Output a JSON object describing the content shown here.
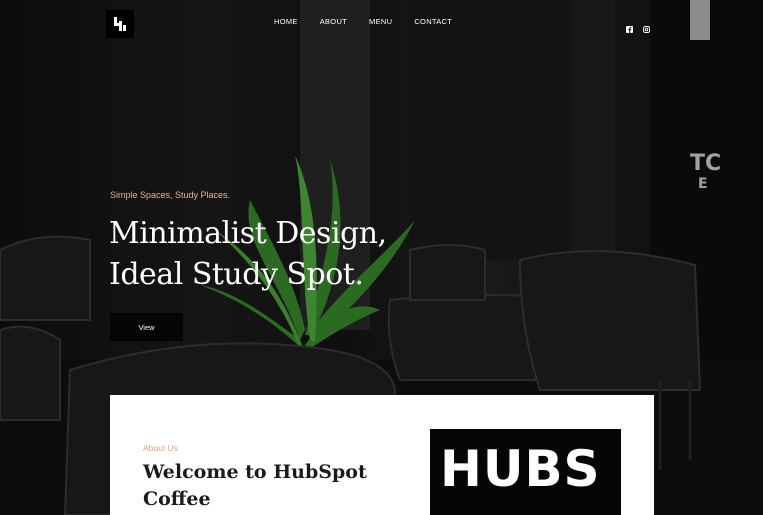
{
  "nav": {
    "items": [
      "HOME",
      "ABOUT",
      "MENU",
      "CONTACT"
    ]
  },
  "social": {
    "icons": [
      "facebook-icon",
      "instagram-icon"
    ]
  },
  "hero": {
    "tagline": "Simple Spaces, Study Places.",
    "headline_line1": "Minimalist Design,",
    "headline_line2": "Ideal Study Spot.",
    "button_label": "View"
  },
  "about": {
    "eyebrow": "About Us",
    "title": "Welcome to HubSpot Coffee",
    "image_text": "HUBS"
  },
  "colors": {
    "accent": "#e9b48f",
    "card_bg": "#ffffff",
    "dark": "#050505"
  }
}
